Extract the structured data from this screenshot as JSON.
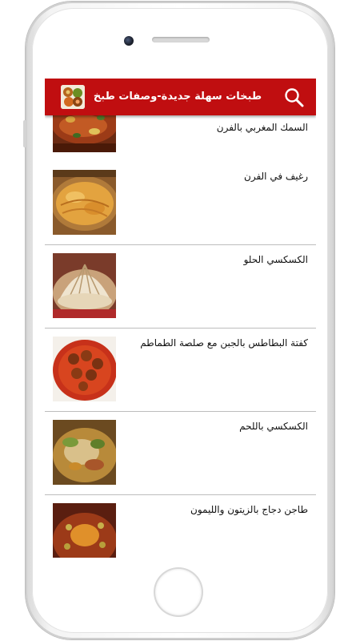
{
  "app": {
    "title": "طبخات سهلة جديدة-وصفات طبخ",
    "header_color": "#c00e10",
    "app_icon": "food-plate-icon",
    "search_icon": "search-icon"
  },
  "recipes": [
    {
      "title": "السمك المغربي بالفرن",
      "thumb": "fish-dish-photo"
    },
    {
      "title": "رغيف في الفرن",
      "thumb": "baked-flatbread-photo"
    },
    {
      "title": "الكسكسي الحلو",
      "thumb": "sweet-couscous-photo"
    },
    {
      "title": "كفتة البطاطس بالجبن مع صلصة الطماطم",
      "thumb": "potato-kofta-photo"
    },
    {
      "title": "الكسكسي باللحم",
      "thumb": "meat-couscous-photo"
    },
    {
      "title": "طاجن دجاج بالزيتون والليمون",
      "thumb": "chicken-tagine-photo"
    }
  ]
}
